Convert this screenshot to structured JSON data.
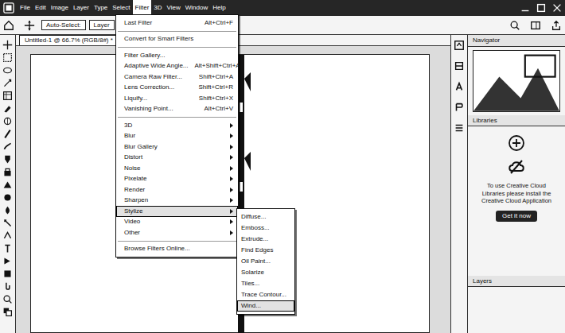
{
  "menubar": {
    "items": [
      {
        "label": "File",
        "selected": false
      },
      {
        "label": "Edit",
        "selected": false
      },
      {
        "label": "Image",
        "selected": false
      },
      {
        "label": "Layer",
        "selected": false
      },
      {
        "label": "Type",
        "selected": false
      },
      {
        "label": "Select",
        "selected": false
      },
      {
        "label": "Filter",
        "selected": true
      },
      {
        "label": "3D",
        "selected": false
      },
      {
        "label": "View",
        "selected": false
      },
      {
        "label": "Window",
        "selected": false
      },
      {
        "label": "Help",
        "selected": false
      }
    ]
  },
  "options_bar": {
    "items": [
      "Auto-Select:",
      "Layer"
    ]
  },
  "document": {
    "tab_title": "Untitled-1 @ 66.7% (RGB/8#) *"
  },
  "filter_menu": {
    "groups": [
      [
        {
          "label": "Last Filter",
          "shortcut": "Alt+Ctrl+F",
          "submenu": false,
          "selected": false
        }
      ],
      [
        {
          "label": "Convert for Smart Filters",
          "shortcut": "",
          "submenu": false,
          "selected": false
        }
      ],
      [
        {
          "label": "Filter Gallery...",
          "shortcut": "",
          "submenu": false,
          "selected": false
        },
        {
          "label": "Adaptive Wide Angle...",
          "shortcut": "Alt+Shift+Ctrl+A",
          "submenu": false,
          "selected": false
        },
        {
          "label": "Camera Raw Filter...",
          "shortcut": "Shift+Ctrl+A",
          "submenu": false,
          "selected": false
        },
        {
          "label": "Lens Correction...",
          "shortcut": "Shift+Ctrl+R",
          "submenu": false,
          "selected": false
        },
        {
          "label": "Liquify...",
          "shortcut": "Shift+Ctrl+X",
          "submenu": false,
          "selected": false
        },
        {
          "label": "Vanishing Point...",
          "shortcut": "Alt+Ctrl+V",
          "submenu": false,
          "selected": false
        }
      ],
      [
        {
          "label": "3D",
          "shortcut": "",
          "submenu": true,
          "selected": false
        },
        {
          "label": "Blur",
          "shortcut": "",
          "submenu": true,
          "selected": false
        },
        {
          "label": "Blur Gallery",
          "shortcut": "",
          "submenu": true,
          "selected": false
        },
        {
          "label": "Distort",
          "shortcut": "",
          "submenu": true,
          "selected": false
        },
        {
          "label": "Noise",
          "shortcut": "",
          "submenu": true,
          "selected": false
        },
        {
          "label": "Pixelate",
          "shortcut": "",
          "submenu": true,
          "selected": false
        },
        {
          "label": "Render",
          "shortcut": "",
          "submenu": true,
          "selected": false
        },
        {
          "label": "Sharpen",
          "shortcut": "",
          "submenu": true,
          "selected": false
        },
        {
          "label": "Stylize",
          "shortcut": "",
          "submenu": true,
          "selected": true
        },
        {
          "label": "Video",
          "shortcut": "",
          "submenu": true,
          "selected": false
        },
        {
          "label": "Other",
          "shortcut": "",
          "submenu": true,
          "selected": false
        }
      ],
      [
        {
          "label": "Browse Filters Online...",
          "shortcut": "",
          "submenu": false,
          "selected": false
        }
      ]
    ]
  },
  "stylize_submenu": {
    "items": [
      {
        "label": "Diffuse...",
        "selected": false
      },
      {
        "label": "Emboss...",
        "selected": false
      },
      {
        "label": "Extrude...",
        "selected": false
      },
      {
        "label": "Find Edges",
        "selected": false
      },
      {
        "label": "Oil Paint...",
        "selected": false
      },
      {
        "label": "Solarize",
        "selected": false
      },
      {
        "label": "Tiles...",
        "selected": false
      },
      {
        "label": "Trace Contour...",
        "selected": false
      },
      {
        "label": "Wind...",
        "selected": true
      }
    ]
  },
  "panels": {
    "top_tab": "Navigator",
    "libraries_tab": "Libraries",
    "message": "To use Creative Cloud Libraries please install the Creative Cloud Application",
    "button": "Get it now",
    "layers_tab": "Layers"
  }
}
